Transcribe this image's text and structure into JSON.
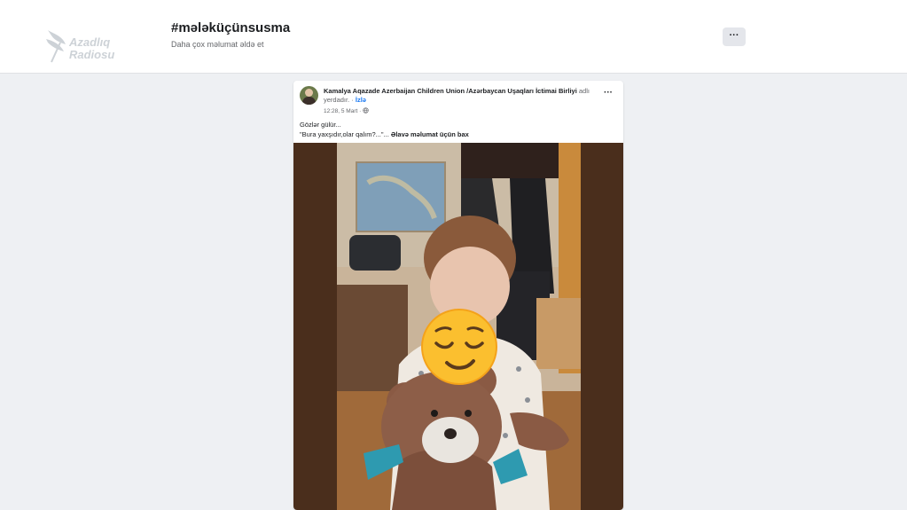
{
  "logo": {
    "line1": "Azadlıq",
    "line2": "Radiosu"
  },
  "hashtag": {
    "title": "#mələküçünsusma",
    "subtitle": "Daha çox məlumat əldə et",
    "more_label": "···"
  },
  "post": {
    "author": "Kamalya Aqazade Azerbaijan Children Union /Azərbaycan Uşaqları İctimai Birliyi",
    "author_suffix": " adlı",
    "location": "yerdadır. · ",
    "follow": "İzlə",
    "timestamp": "12:28, 5 Mart · ",
    "menu": "···",
    "line1": "Gözlər gülür...",
    "line2": "\"Bura yaxşıdır,olar qalım?...\"... ",
    "see_more": "Əlavə məlumat üçün bax"
  },
  "colors": {
    "accent": "#1877f2",
    "page_bg": "#eef0f3",
    "photo_frame": "#4a2e1c"
  },
  "icons": {
    "logo": "feather-logo-icon",
    "globe": "globe-icon",
    "emoji": "relieved-face-emoji-icon"
  }
}
